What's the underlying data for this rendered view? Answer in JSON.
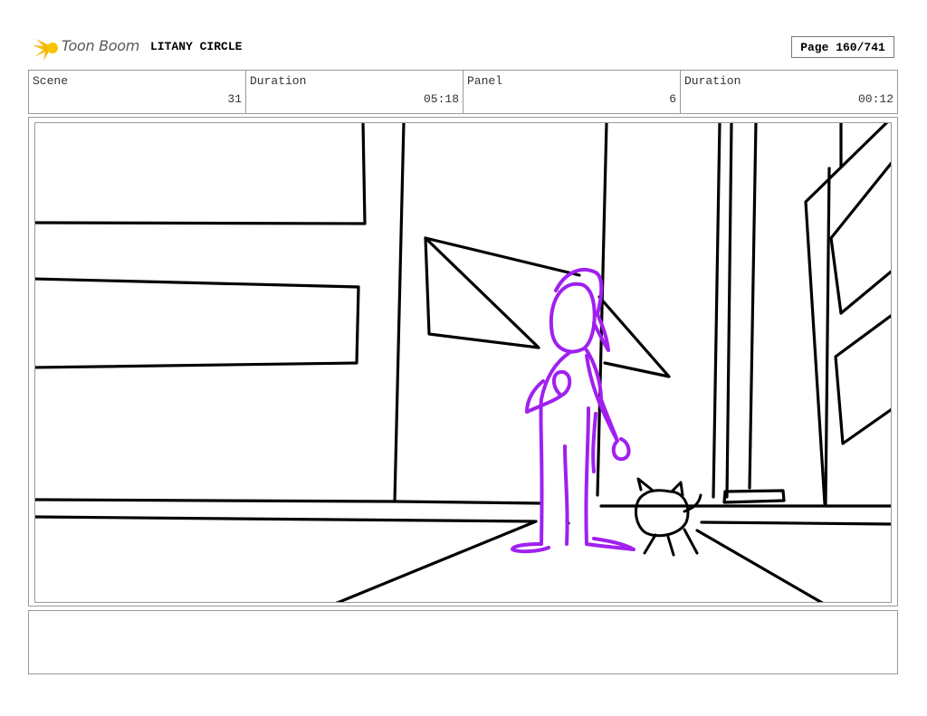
{
  "header": {
    "logo_text": "Toon Boom",
    "project_title": "LITANY CIRCLE",
    "page_indicator": "Page 160/741"
  },
  "info": [
    {
      "label": "Scene",
      "value": "31"
    },
    {
      "label": "Duration",
      "value": "05:18"
    },
    {
      "label": "Panel",
      "value": "6"
    },
    {
      "label": "Duration",
      "value": "00:12"
    }
  ],
  "colors": {
    "sketch_line": "#000000",
    "character_stroke": "#a020f0",
    "logo_accent": "#f5b800"
  },
  "notes": ""
}
